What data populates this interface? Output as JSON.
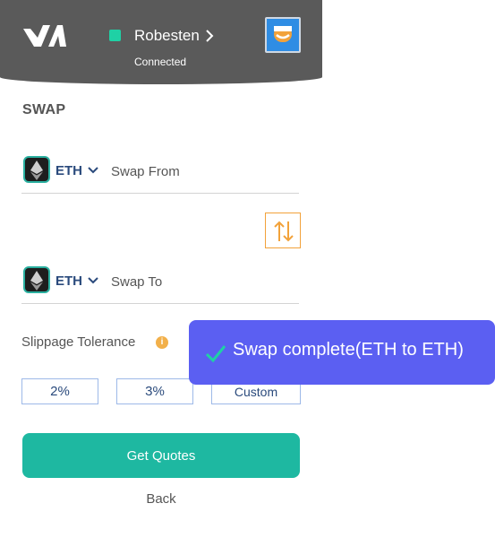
{
  "header": {
    "account_name": "Robesten",
    "account_status": "Connected",
    "status_color": "#1fd1a5",
    "logo_icon": "logo-icon",
    "avatar_icon": "avatar-icon"
  },
  "swap": {
    "title": "SWAP",
    "from": {
      "token": "ETH",
      "label": "Swap From",
      "icon": "ethereum-icon"
    },
    "to": {
      "token": "ETH",
      "label": "Swap To",
      "icon": "ethereum-icon"
    },
    "toggle_icon": "swap-arrows-icon"
  },
  "slippage": {
    "label": "Slippage Tolerance",
    "info_icon": "info-icon",
    "options": [
      "2%",
      "3%",
      "Custom"
    ]
  },
  "actions": {
    "get_quotes": "Get Quotes",
    "back": "Back"
  },
  "toast": {
    "message": "Swap complete(ETH to ETH)",
    "icon": "check-icon",
    "color": "#5b5ff2"
  },
  "colors": {
    "accent": "#1eb8a1",
    "warning": "#f2a23a",
    "header": "#5a5a5a"
  }
}
